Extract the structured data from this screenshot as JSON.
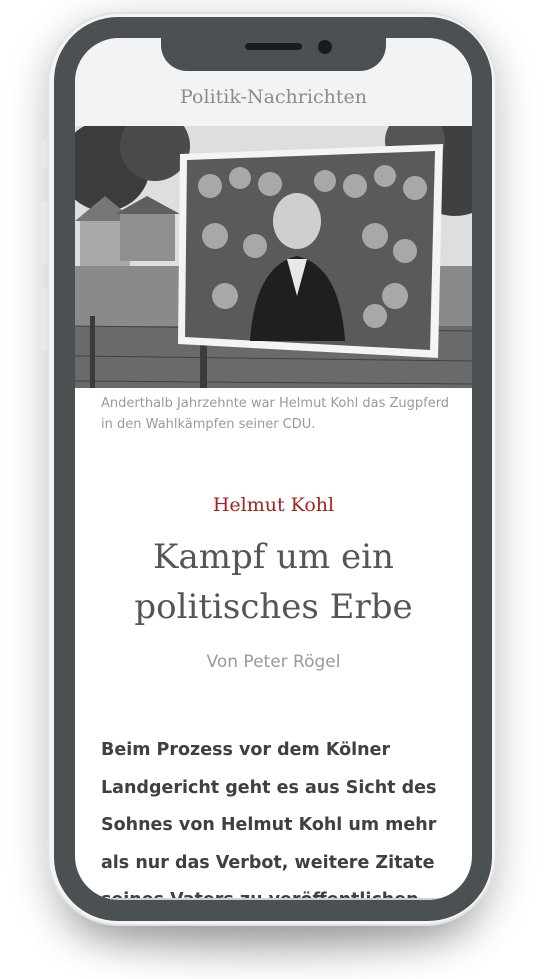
{
  "header": {
    "title": "Politik-Nachrichten"
  },
  "article": {
    "photo_caption": "Anderthalb Jahrzehnte war Helmut Kohl das Zugpferd in den Wahlkämpfen seiner CDU.",
    "kicker": "Helmut Kohl",
    "headline": "Kampf um ein politisches Erbe",
    "author": "Von Peter Rögel",
    "lead": "Beim Prozess vor dem Kölner Landgericht geht es aus Sicht des Sohnes von Helmut Kohl um mehr als nur das Verbot, weitere Zitate seines Vaters zu veröffentlichen."
  },
  "colors": {
    "kicker": "#a3221f",
    "frame": "#4b5052",
    "header_bg": "#f3f3f5"
  }
}
